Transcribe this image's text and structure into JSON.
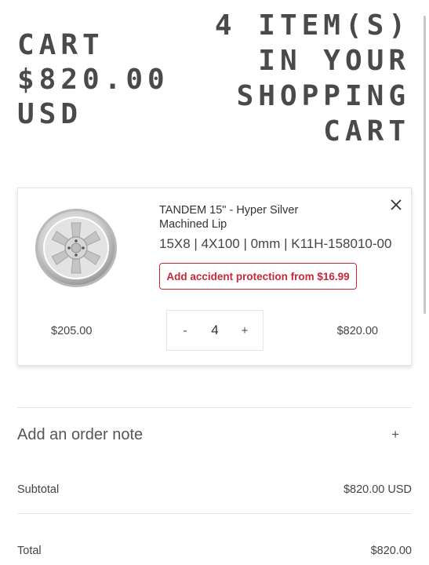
{
  "header": {
    "cart_line1": "CART",
    "cart_line2": "$820.00",
    "cart_line3": "USD",
    "items_line1": "4 ITEM(S)",
    "items_line2": "IN YOUR",
    "items_line3": "SHOPPING",
    "items_line4": "CART"
  },
  "cart_item": {
    "title_line1": "TANDEM 15\" - Hyper Silver",
    "title_line2": "Machined Lip",
    "variant": "15X8 | 4X100 | 0mm | K11H-158010-00",
    "protection_label": "Add accident protection from $16.99",
    "unit_price": "$205.00",
    "quantity": "4",
    "decrement_label": "-",
    "increment_label": "+",
    "line_total": "$820.00",
    "image_icon": "wheel-image",
    "remove_icon": "close-icon"
  },
  "order_note": {
    "label": "Add an order note",
    "toggle_label": "+"
  },
  "summary": {
    "subtotal_label": "Subtotal",
    "subtotal_value": "$820.00 USD",
    "total_label": "Total",
    "total_value": "$820.00"
  },
  "colors": {
    "heading": "#4a4a4a",
    "protection_accent": "#c9273a",
    "divider": "#e3e3e3"
  }
}
